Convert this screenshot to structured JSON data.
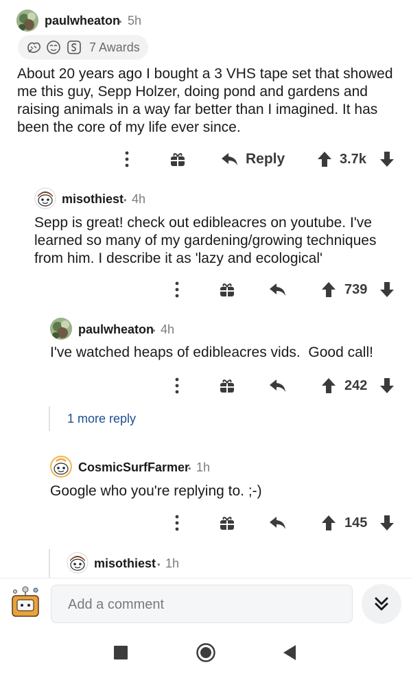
{
  "comments": [
    {
      "username": "paulwheaton",
      "age": "5h",
      "awards": "7 Awards",
      "body": "About 20 years ago I bought a 3 VHS tape set that showed me this guy, Sepp Holzer, doing pond and gardens and raising animals in a way far better than I imagined. It has been the core of my life ever since.",
      "reply_label": "Reply",
      "votes": "3.7k"
    },
    {
      "username": "misothiest",
      "age": "4h",
      "body": "Sepp is great! check out edibleacres on youtube. I've learned so many of my gardening/growing techniques from him. I describe it as 'lazy and ecological'",
      "votes": "739"
    },
    {
      "username": "paulwheaton",
      "age": "4h",
      "body": "I've watched heaps of edibleacres vids.  Good call!",
      "votes": "242"
    },
    {
      "username": "CosmicSurfFarmer",
      "age": "1h",
      "body": "Google who you're replying to. ;-)",
      "votes": "145"
    },
    {
      "username": "misothiest",
      "age": "1h"
    }
  ],
  "more_replies": "1 more reply",
  "separator": "•",
  "composer": {
    "placeholder": "Add a comment"
  },
  "icons": {
    "overflow": "more-vertical-icon",
    "gift": "gift-icon",
    "reply": "reply-arrow-icon",
    "upvote": "upvote-arrow-icon",
    "downvote": "downvote-arrow-icon",
    "jump": "double-chevron-down-icon",
    "nav_back": "back-triangle-icon",
    "nav_home": "home-circle-icon",
    "nav_recents": "recents-square-icon"
  },
  "colors": {
    "text": "#1a1a1b",
    "meta": "#7c7c7c",
    "link": "#1d4f91",
    "icon": "#3b3b3b",
    "thread_line": "#e2e2e2"
  }
}
